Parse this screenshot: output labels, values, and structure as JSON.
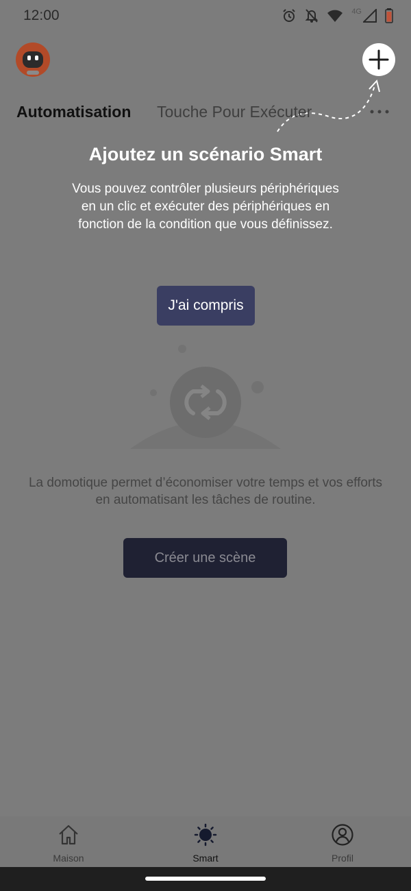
{
  "status_bar": {
    "time": "12:00",
    "network": "4G",
    "icons": [
      "alarm-icon",
      "notifications-off-icon",
      "wifi-icon",
      "signal-icon",
      "battery-icon"
    ]
  },
  "header": {
    "avatar_icon": "robot-avatar-icon",
    "add_icon": "plus-icon",
    "more_icon": "more-horizontal-icon",
    "tabs": [
      {
        "label": "Automatisation",
        "active": true
      },
      {
        "label": "Touche Pour Exécuter",
        "active": false
      }
    ]
  },
  "guide": {
    "title": "Ajoutez un scénario Smart",
    "description": "Vous pouvez contrôler plusieurs périphériques en un clic et exécuter des périphériques en fonction de la condition que vous définissez.",
    "button_label": "J'ai compris"
  },
  "empty_state": {
    "icon": "automation-sync-icon",
    "description": "La domotique permet d’économiser votre temps et vos efforts en automatisant les tâches de routine.",
    "button_label": "Créer une scène"
  },
  "bottom_nav": {
    "items": [
      {
        "label": "Maison",
        "icon": "home-icon",
        "active": false
      },
      {
        "label": "Smart",
        "icon": "sun-icon",
        "active": true
      },
      {
        "label": "Profil",
        "icon": "user-profile-icon",
        "active": false
      }
    ]
  },
  "colors": {
    "overlay": "#7c7c7c",
    "guide_button": "#3a3e62",
    "primary_button": "#1f2133",
    "battery": "#c0533a"
  }
}
